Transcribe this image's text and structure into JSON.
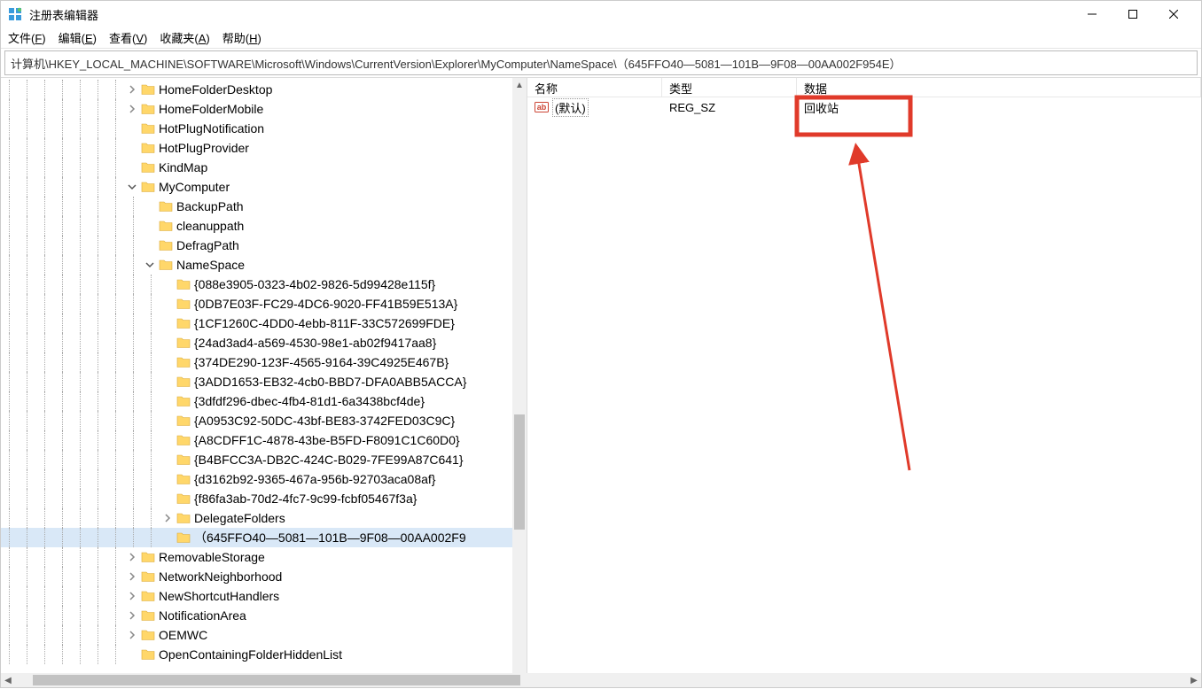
{
  "title": "注册表编辑器",
  "menu": {
    "file": "文件(F)",
    "edit": "编辑(E)",
    "view": "查看(V)",
    "favorites": "收藏夹(A)",
    "help": "帮助(H)"
  },
  "address": "计算机\\HKEY_LOCAL_MACHINE\\SOFTWARE\\Microsoft\\Windows\\CurrentVersion\\Explorer\\MyComputer\\NameSpace\\（645FFO40—5081—101B—9F08—00AA002F954E）",
  "tree": [
    {
      "depth": 8,
      "exp": "collapsed",
      "label": "HomeFolderDesktop"
    },
    {
      "depth": 8,
      "exp": "collapsed",
      "label": "HomeFolderMobile"
    },
    {
      "depth": 8,
      "exp": "none",
      "label": "HotPlugNotification"
    },
    {
      "depth": 8,
      "exp": "none",
      "label": "HotPlugProvider"
    },
    {
      "depth": 8,
      "exp": "none",
      "label": "KindMap"
    },
    {
      "depth": 8,
      "exp": "expanded",
      "label": "MyComputer"
    },
    {
      "depth": 9,
      "exp": "none",
      "label": "BackupPath"
    },
    {
      "depth": 9,
      "exp": "none",
      "label": "cleanuppath"
    },
    {
      "depth": 9,
      "exp": "none",
      "label": "DefragPath"
    },
    {
      "depth": 9,
      "exp": "expanded",
      "label": "NameSpace"
    },
    {
      "depth": 10,
      "exp": "none",
      "label": "{088e3905-0323-4b02-9826-5d99428e115f}"
    },
    {
      "depth": 10,
      "exp": "none",
      "label": "{0DB7E03F-FC29-4DC6-9020-FF41B59E513A}"
    },
    {
      "depth": 10,
      "exp": "none",
      "label": "{1CF1260C-4DD0-4ebb-811F-33C572699FDE}"
    },
    {
      "depth": 10,
      "exp": "none",
      "label": "{24ad3ad4-a569-4530-98e1-ab02f9417aa8}"
    },
    {
      "depth": 10,
      "exp": "none",
      "label": "{374DE290-123F-4565-9164-39C4925E467B}"
    },
    {
      "depth": 10,
      "exp": "none",
      "label": "{3ADD1653-EB32-4cb0-BBD7-DFA0ABB5ACCA}"
    },
    {
      "depth": 10,
      "exp": "none",
      "label": "{3dfdf296-dbec-4fb4-81d1-6a3438bcf4de}"
    },
    {
      "depth": 10,
      "exp": "none",
      "label": "{A0953C92-50DC-43bf-BE83-3742FED03C9C}"
    },
    {
      "depth": 10,
      "exp": "none",
      "label": "{A8CDFF1C-4878-43be-B5FD-F8091C1C60D0}"
    },
    {
      "depth": 10,
      "exp": "none",
      "label": "{B4BFCC3A-DB2C-424C-B029-7FE99A87C641}"
    },
    {
      "depth": 10,
      "exp": "none",
      "label": "{d3162b92-9365-467a-956b-92703aca08af}"
    },
    {
      "depth": 10,
      "exp": "none",
      "label": "{f86fa3ab-70d2-4fc7-9c99-fcbf05467f3a}"
    },
    {
      "depth": 10,
      "exp": "collapsed",
      "label": "DelegateFolders"
    },
    {
      "depth": 10,
      "exp": "none",
      "label": "（645FFO40—5081—101B—9F08—00AA002F9",
      "selected": true
    },
    {
      "depth": 8,
      "exp": "collapsed",
      "label": "RemovableStorage"
    },
    {
      "depth": 8,
      "exp": "collapsed",
      "label": "NetworkNeighborhood"
    },
    {
      "depth": 8,
      "exp": "collapsed",
      "label": "NewShortcutHandlers"
    },
    {
      "depth": 8,
      "exp": "collapsed",
      "label": "NotificationArea"
    },
    {
      "depth": 8,
      "exp": "collapsed",
      "label": "OEMWC"
    },
    {
      "depth": 8,
      "exp": "none",
      "label": "OpenContainingFolderHiddenList"
    }
  ],
  "list": {
    "columns": {
      "name": "名称",
      "type": "类型",
      "data": "数据"
    },
    "rows": [
      {
        "name": "(默认)",
        "type": "REG_SZ",
        "data": "回收站"
      }
    ]
  },
  "colWidths": {
    "name": 152,
    "type": 152
  }
}
